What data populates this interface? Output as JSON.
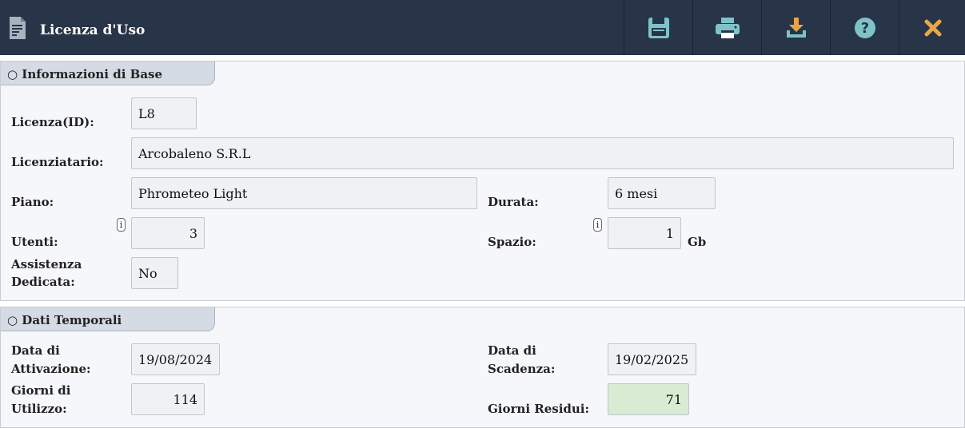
{
  "header": {
    "title": "Licenza d'Uso",
    "toolbar": [
      {
        "name": "save-button",
        "icon": "floppy-disk-icon"
      },
      {
        "name": "print-button",
        "icon": "printer-icon"
      },
      {
        "name": "download-button",
        "icon": "download-icon"
      },
      {
        "name": "help-button",
        "icon": "question-circle-icon"
      },
      {
        "name": "close-button",
        "icon": "close-x-icon"
      }
    ]
  },
  "colors": {
    "header_bg": "#283447",
    "toolbar_icon": "#7fc3c9",
    "close_icon": "#e8a64a",
    "positive_field": "#d8ecd3"
  },
  "base": {
    "section_title": "○ Informazioni di Base",
    "licenza_label": "Licenza(ID):",
    "licenza_value": "L8",
    "licenziatario_label": "Licenziatario:",
    "licenziatario_value": "Arcobaleno S.R.L",
    "piano_label": "Piano:",
    "piano_value": "Phrometeo Light",
    "durata_label": "Durata:",
    "durata_value": "6 mesi",
    "utenti_label": "Utenti:",
    "utenti_value": "3",
    "spazio_label": "Spazio:",
    "spazio_value": "1",
    "spazio_unit": "Gb",
    "assistenza_label_1": "Assistenza",
    "assistenza_label_2": "Dedicata:",
    "assistenza_value": "No",
    "info_glyph": "i"
  },
  "temporali": {
    "section_title": "○ Dati Temporali",
    "attivazione_label_1": "Data di",
    "attivazione_label_2": "Attivazione:",
    "attivazione_value": "19/08/2024",
    "scadenza_label_1": "Data di",
    "scadenza_label_2": "Scadenza:",
    "scadenza_value": "19/02/2025",
    "utilizzo_label_1": "Giorni di",
    "utilizzo_label_2": "Utilizzo:",
    "utilizzo_value": "114",
    "residui_label": "Giorni Residui:",
    "residui_value": "71"
  }
}
